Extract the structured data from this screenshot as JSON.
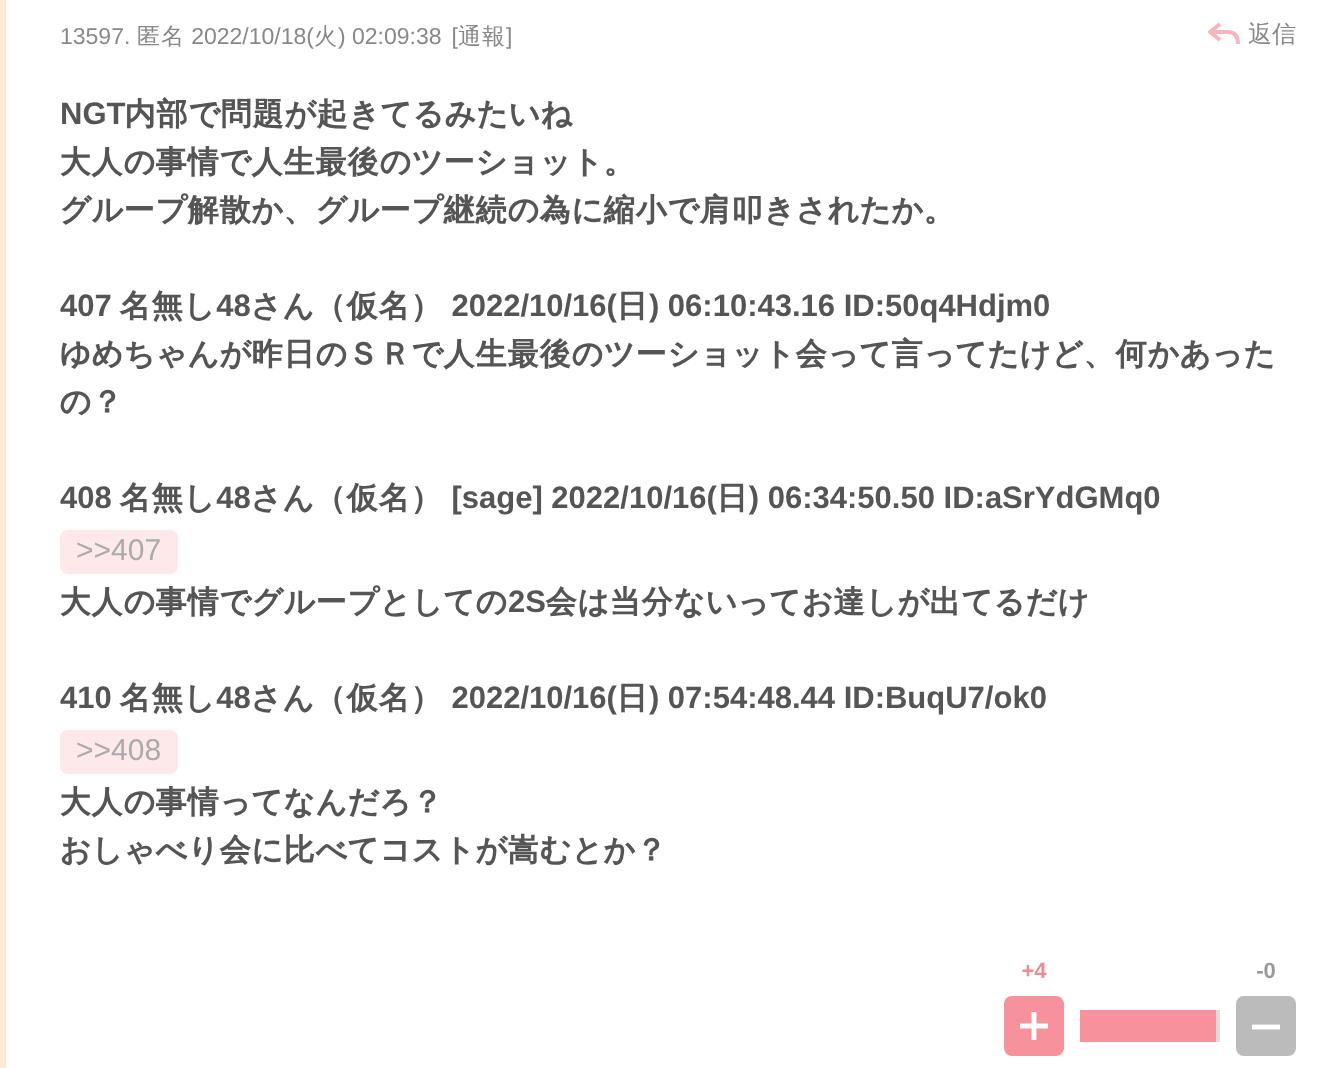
{
  "header": {
    "meta": "13597. 匿名 2022/10/18(火) 02:09:38",
    "report": "[通報]",
    "reply": "返信"
  },
  "blocks": [
    {
      "kind": "text",
      "lines": [
        "NGT内部で問題が起きてるみたいね",
        "大人の事情で人生最後のツーショット。",
        "グループ解散か、グループ継続の為に縮小で肩叩きされたか。"
      ]
    },
    {
      "kind": "gap"
    },
    {
      "kind": "text",
      "lines": [
        "407 名無し48さん（仮名） 2022/10/16(日) 06:10:43.16 ID:50q4Hdjm0",
        "ゆめちゃんが昨日のＳＲで人生最後のツーショット会って言ってたけど、何かあったの？"
      ]
    },
    {
      "kind": "gap"
    },
    {
      "kind": "text",
      "lines": [
        "408 名無し48さん（仮名） [sage] 2022/10/16(日) 06:34:50.50 ID:aSrYdGMq0"
      ]
    },
    {
      "kind": "anchor",
      "label": ">>407"
    },
    {
      "kind": "text",
      "lines": [
        "大人の事情でグループとしての2S会は当分ないってお達しが出てるだけ"
      ]
    },
    {
      "kind": "gap"
    },
    {
      "kind": "text",
      "lines": [
        "410 名無し48さん（仮名） 2022/10/16(日) 07:54:48.44 ID:BuqU7/ok0"
      ]
    },
    {
      "kind": "anchor",
      "label": ">>408"
    },
    {
      "kind": "text",
      "lines": [
        "大人の事情ってなんだろ？",
        "おしゃべり会に比べてコストが嵩むとか？"
      ]
    }
  ],
  "votes": {
    "plus": "+4",
    "minus": "-0",
    "level": 0.97
  }
}
